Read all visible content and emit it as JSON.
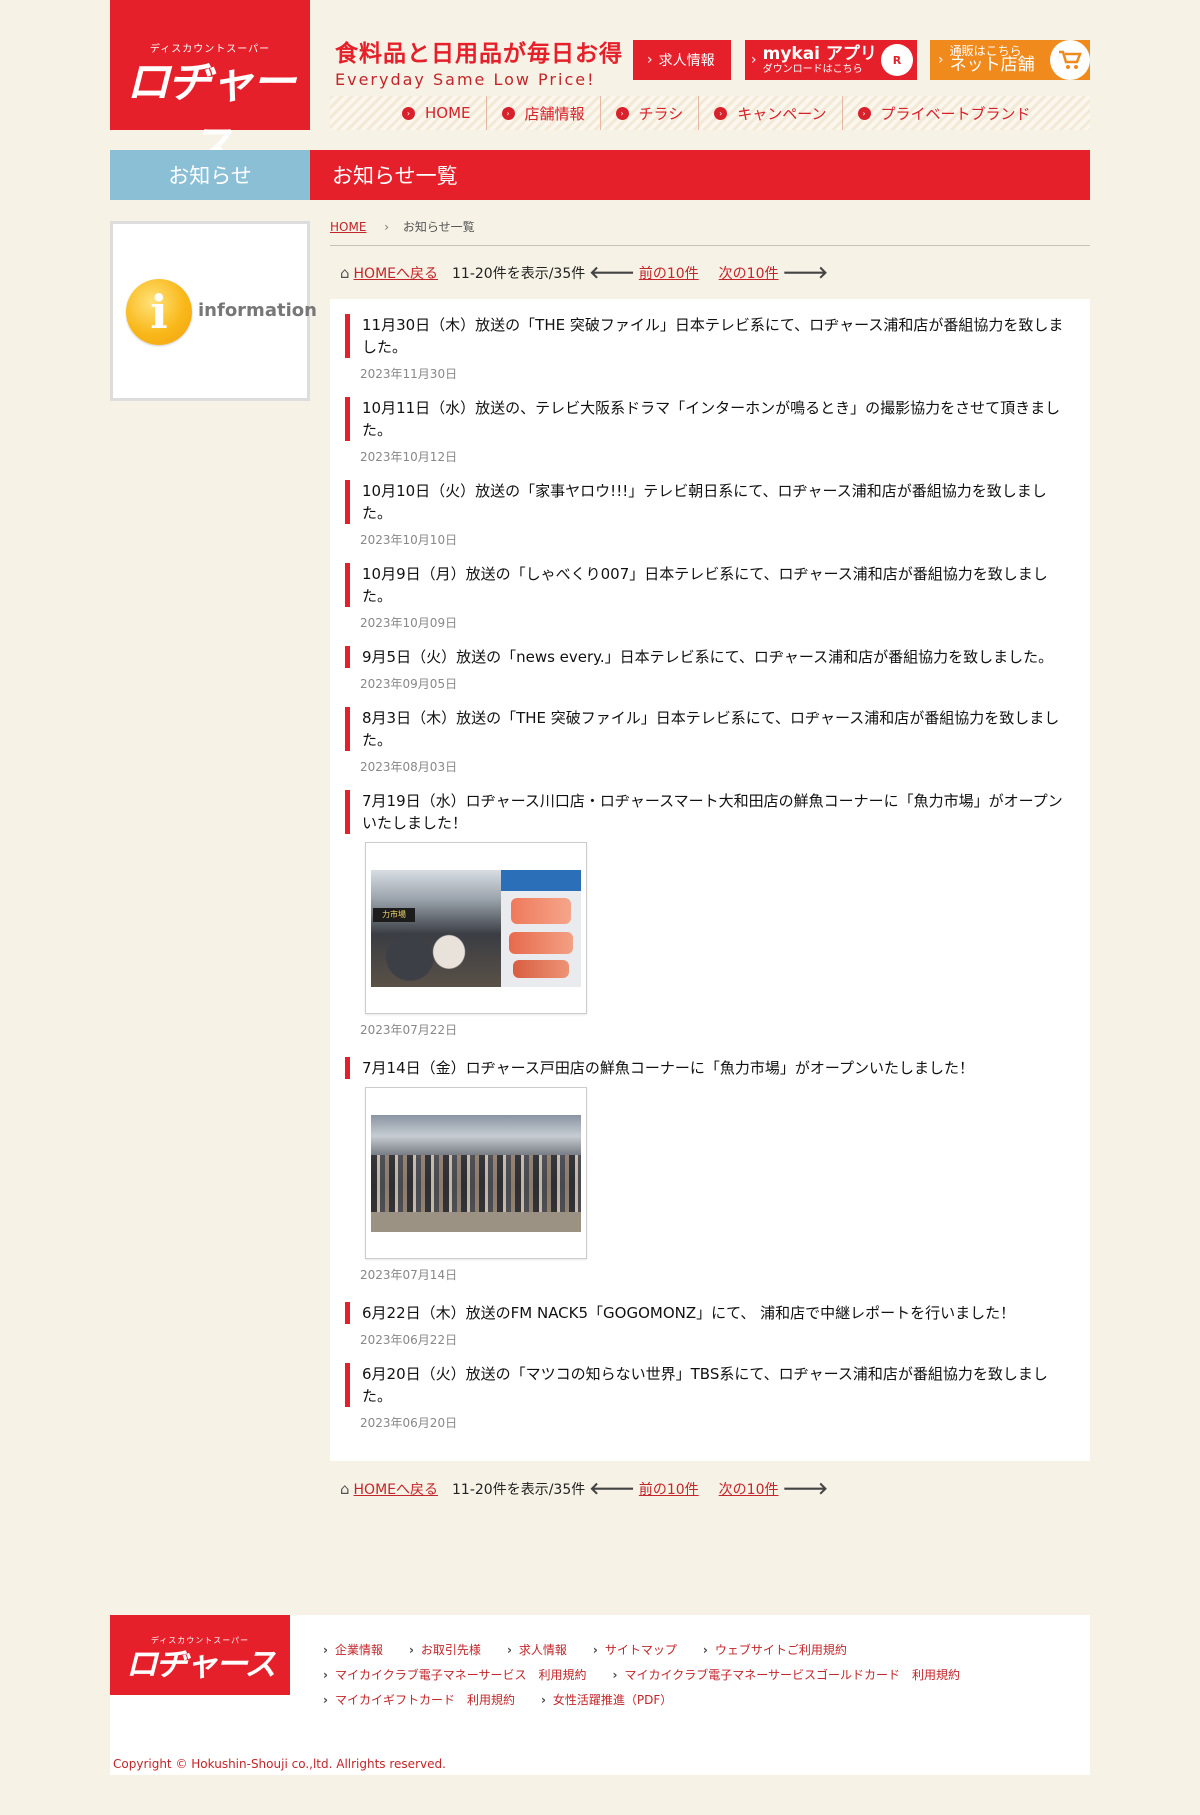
{
  "header": {
    "logo_sub": "ディスカウントスーパー",
    "logo_main": "ロヂャース",
    "tagline_jp": "食料品と日用品が毎日お得",
    "tagline_en": "Everyday Same Low Price!",
    "job_button": "求人情報",
    "app_button": {
      "title": "mykai アプリ",
      "sub": "ダウンロードはこちら",
      "badge": "R"
    },
    "shop_button": {
      "sub": "通販はこちら",
      "main": "ネット店舗"
    },
    "nav": [
      "HOME",
      "店舗情報",
      "チラシ",
      "キャンペーン",
      "プライベートブランド"
    ]
  },
  "sidebar": {
    "title": "お知らせ",
    "info_letter": "i",
    "info_word": "information"
  },
  "main": {
    "title": "お知らせ一覧",
    "breadcrumb": {
      "home": "HOME",
      "current": "お知らせ一覧"
    },
    "pager": {
      "home_link": "HOMEへ戻る",
      "range": "11-20件を表示/35件",
      "prev": "前の10件",
      "next": "次の10件"
    },
    "news": [
      {
        "title": "11月30日（木）放送の「THE 突破ファイル」日本テレビ系にて、ロヂャース浦和店が番組協力を致しました。",
        "date": "2023年11月30日"
      },
      {
        "title": "10月11日（水）放送の、テレビ大阪系ドラマ「インターホンが鳴るとき」の撮影協力をさせて頂きました。",
        "date": "2023年10月12日"
      },
      {
        "title": "10月10日（火）放送の「家事ヤロウ!!!」テレビ朝日系にて、ロヂャース浦和店が番組協力を致しました。",
        "date": "2023年10月10日"
      },
      {
        "title": "10月9日（月）放送の「しゃべくり007」日本テレビ系にて、ロヂャース浦和店が番組協力を致しました。",
        "date": "2023年10月09日"
      },
      {
        "title": "9月5日（火）放送の「news every.」日本テレビ系にて、ロヂャース浦和店が番組協力を致しました。",
        "date": "2023年09月05日"
      },
      {
        "title": "8月3日（木）放送の「THE 突破ファイル」日本テレビ系にて、ロヂャース浦和店が番組協力を致しました。",
        "date": "2023年08月03日"
      },
      {
        "title": "7月19日（水）ロヂャース川口店・ロヂャースマート大和田店の鮮魚コーナーに「魚力市場」がオープンいたしました！",
        "date": "2023年07月22日"
      },
      {
        "title": "7月14日（金）ロヂャース戸田店の鮮魚コーナーに「魚力市場」がオープンいたしました！",
        "date": "2023年07月14日"
      },
      {
        "title": "6月22日（木）放送のFM NACK5「GOGOMONZ」にて、 浦和店で中継レポートを行いました！",
        "date": "2023年06月22日"
      },
      {
        "title": "6月20日（火）放送の「マツコの知らない世界」TBS系にて、ロヂャース浦和店が番組協力を致しました。",
        "date": "2023年06月20日"
      }
    ],
    "photo_sign": "力市場"
  },
  "footer": {
    "logo_sub": "ディスカウントスーパー",
    "logo_main": "ロヂャース",
    "links_row1": [
      "企業情報",
      "お取引先様",
      "求人情報",
      "サイトマップ",
      "ウェブサイトご利用規約"
    ],
    "links_row2": [
      "マイカイクラブ電子マネーサービス　利用規約",
      "マイカイクラブ電子マネーサービスゴールドカード　利用規約"
    ],
    "links_row3": [
      "マイカイギフトカード　利用規約",
      "女性活躍推進（PDF）"
    ],
    "copyright": "Copyright © Hokushin-Shouji co.,ltd. Allrights reserved."
  },
  "colors": {
    "brand_red": "#e5202a",
    "sidebar_blue": "#8bbfd6",
    "shop_orange": "#f08a1c",
    "background": "#f7f2e6"
  }
}
